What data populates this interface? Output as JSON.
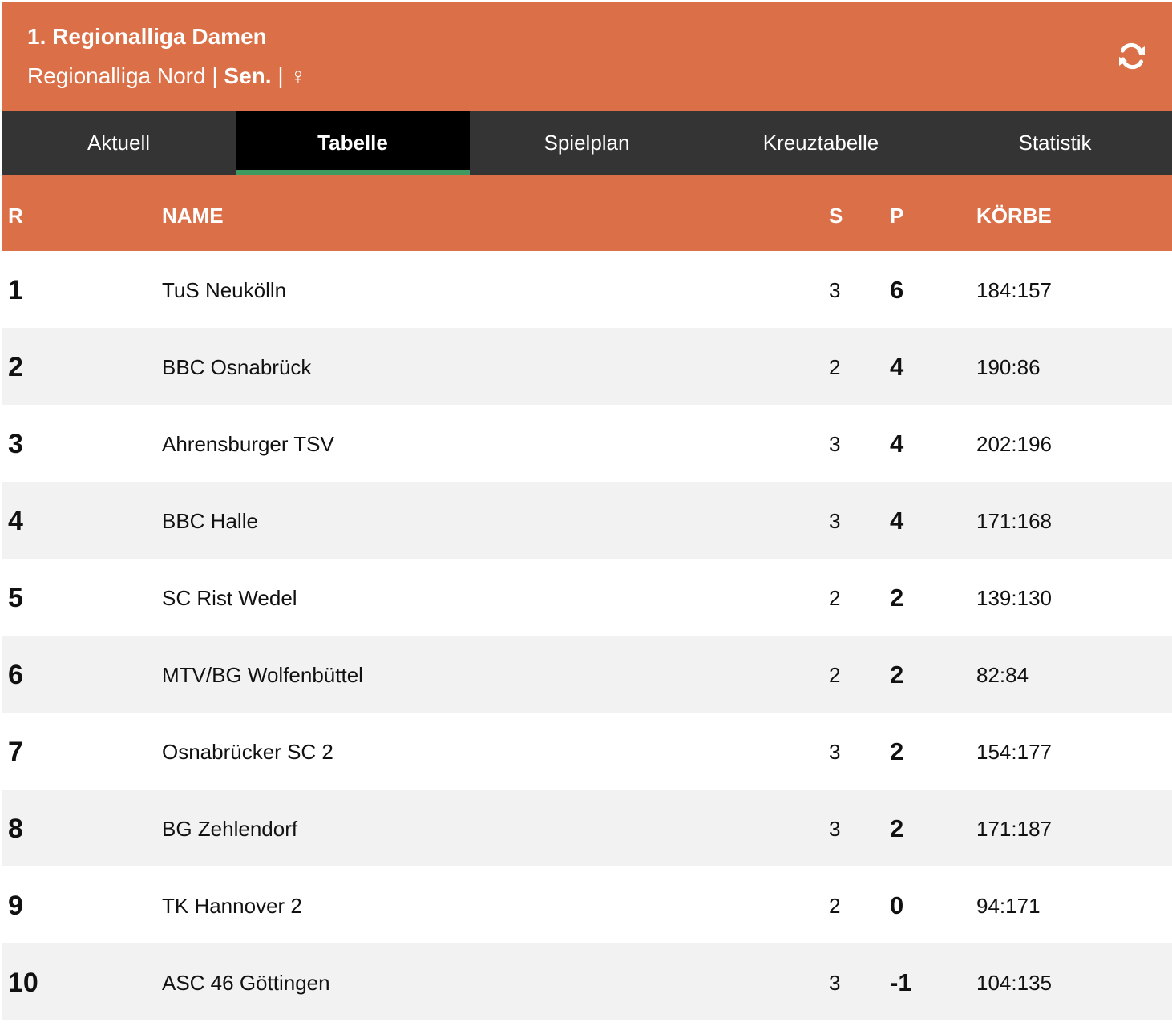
{
  "header": {
    "title": "1. Regionalliga Damen",
    "subtitle_league": "Regionalliga Nord |",
    "subtitle_age": "Sen.",
    "subtitle_sep": "|",
    "subtitle_gender": "♀",
    "refresh_icon": "refresh-icon"
  },
  "tabs": [
    {
      "label": "Aktuell",
      "active": false
    },
    {
      "label": "Tabelle",
      "active": true
    },
    {
      "label": "Spielplan",
      "active": false
    },
    {
      "label": "Kreuztabelle",
      "active": false
    },
    {
      "label": "Statistik",
      "active": false
    }
  ],
  "table": {
    "headers": {
      "rank": "R",
      "name": "NAME",
      "games": "S",
      "points": "P",
      "baskets": "KÖRBE"
    },
    "rows": [
      {
        "rank": "1",
        "name": "TuS Neukölln",
        "games": "3",
        "points": "6",
        "baskets": "184:157"
      },
      {
        "rank": "2",
        "name": "BBC Osnabrück",
        "games": "2",
        "points": "4",
        "baskets": "190:86"
      },
      {
        "rank": "3",
        "name": "Ahrensburger TSV",
        "games": "3",
        "points": "4",
        "baskets": "202:196"
      },
      {
        "rank": "4",
        "name": "BBC Halle",
        "games": "3",
        "points": "4",
        "baskets": "171:168"
      },
      {
        "rank": "5",
        "name": "SC Rist Wedel",
        "games": "2",
        "points": "2",
        "baskets": "139:130"
      },
      {
        "rank": "6",
        "name": "MTV/BG Wolfenbüttel",
        "games": "2",
        "points": "2",
        "baskets": "82:84"
      },
      {
        "rank": "7",
        "name": "Osnabrücker SC 2",
        "games": "3",
        "points": "2",
        "baskets": "154:177"
      },
      {
        "rank": "8",
        "name": "BG Zehlendorf",
        "games": "3",
        "points": "2",
        "baskets": "171:187"
      },
      {
        "rank": "9",
        "name": "TK Hannover 2",
        "games": "2",
        "points": "0",
        "baskets": "94:171"
      },
      {
        "rank": "10",
        "name": "ASC 46 Göttingen",
        "games": "3",
        "points": "-1",
        "baskets": "104:135"
      }
    ]
  },
  "colors": {
    "accent": "#db7048",
    "tabbar": "#343434",
    "tab_active": "#000000",
    "tab_indicator": "#3f9a62",
    "row_alt": "#f2f2f2"
  }
}
